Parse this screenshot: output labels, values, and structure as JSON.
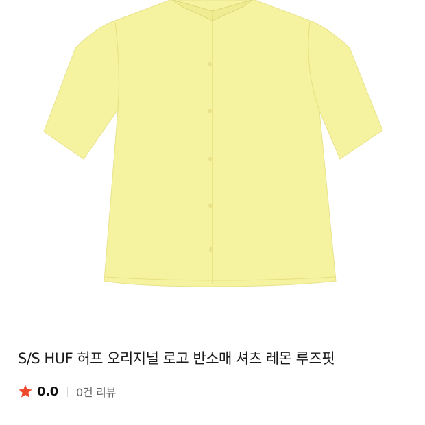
{
  "product": {
    "title": "S/S HUF 허프 오리지널 로고 반소매 셔츠 레몬 루즈핏",
    "image_icon": "shirt-image",
    "shirt_color": "#f5f3a0"
  },
  "rating": {
    "icon": "star-icon",
    "star_color": "#f04a2d",
    "score": "0.0",
    "reviews_label": "0건 리뷰"
  }
}
